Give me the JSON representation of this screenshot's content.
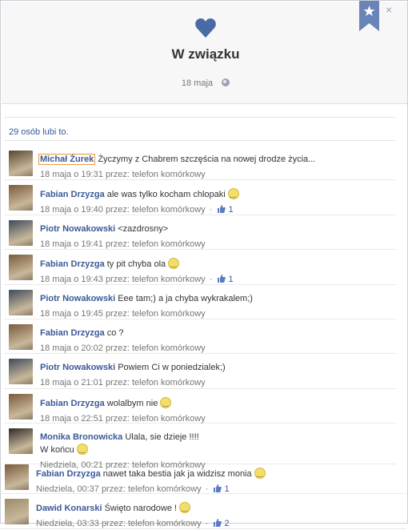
{
  "header": {
    "title": "W związku",
    "date": "18 maja",
    "close_label": "×"
  },
  "likes": {
    "text": "29 osób lubi to."
  },
  "comments": [
    {
      "author": "Michał Żurek",
      "text": "Życzymy z Chabrem szczęścia na nowej drodze życia...",
      "meta": "18 maja o 19:31 przez: telefon komórkowy",
      "likes": null,
      "smiley": false,
      "boxed": true
    },
    {
      "author": "Fabian Drzyzga",
      "text": "ale was tylko kocham chlopaki",
      "meta": "18 maja o 19:40 przez: telefon komórkowy",
      "likes": "1",
      "smiley": true
    },
    {
      "author": "Piotr Nowakowski",
      "text": "<zazdrosny>",
      "meta": "18 maja o 19:41 przez: telefon komórkowy",
      "likes": null,
      "smiley": false
    },
    {
      "author": "Fabian Drzyzga",
      "text": "ty pit chyba ola",
      "meta": "18 maja o 19:43 przez: telefon komórkowy",
      "likes": "1",
      "smiley": true
    },
    {
      "author": "Piotr Nowakowski",
      "text": "Eee tam;) a ja chyba wykrakalem;)",
      "meta": "18 maja o 19:45 przez: telefon komórkowy",
      "likes": null,
      "smiley": false
    },
    {
      "author": "Fabian Drzyzga",
      "text": "co ?",
      "meta": "18 maja o 20:02 przez: telefon komórkowy",
      "likes": null,
      "smiley": false
    },
    {
      "author": "Piotr Nowakowski",
      "text": "Powiem Ci w poniedzialek;)",
      "meta": "18 maja o 21:01 przez: telefon komórkowy",
      "likes": null,
      "smiley": false
    },
    {
      "author": "Fabian Drzyzga",
      "text": "wolalbym nie",
      "meta": "18 maja o 22:51 przez: telefon komórkowy",
      "likes": null,
      "smiley": true
    },
    {
      "author": "Monika Bronowicka",
      "text": "Ulala, sie dzieje !!!!",
      "text2": "W końcu",
      "meta": "Niedziela, 00:21 przez: telefon komórkowy",
      "likes": null,
      "smiley": true
    }
  ],
  "last_comments": [
    {
      "author": "Fabian Drzyzga",
      "text": "nawet taka bestia jak ja widzisz monia",
      "meta": "Niedziela, 00:37 przez: telefon komórkowy",
      "likes": "1",
      "smiley": true
    },
    {
      "author": "Dawid Konarski",
      "text": "Święto narodowe !",
      "meta": "Niedziela, 03:33 przez: telefon komórkowy",
      "likes": "2",
      "smiley": true
    }
  ],
  "colors": {
    "link": "#3b5998",
    "heart": "#4a6aa5",
    "bookmark": "#6b84b8"
  },
  "icons": [
    "heart-icon",
    "bookmark-star-icon",
    "close-icon",
    "globe-icon",
    "smiley-icon",
    "thumbs-up-icon"
  ]
}
